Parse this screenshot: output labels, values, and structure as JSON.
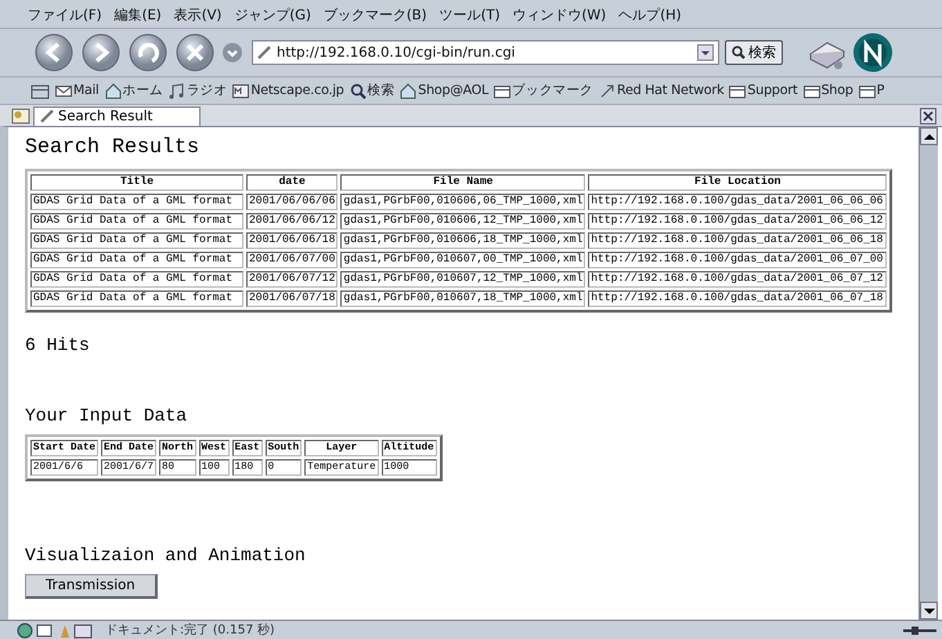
{
  "menu": [
    "ファイル(F)",
    "編集(E)",
    "表示(V)",
    "ジャンプ(G)",
    "ブックマーク(B)",
    "ツール(T)",
    "ウィンドウ(W)",
    "ヘルプ(H)"
  ],
  "address": {
    "value": "http://192.168.0.10/cgi-bin/run.cgi"
  },
  "search_button": "検索",
  "personal_bar": [
    {
      "label": "Mail",
      "kind": "mail"
    },
    {
      "label": "ホーム",
      "kind": "home"
    },
    {
      "label": "ラジオ",
      "kind": "music"
    },
    {
      "label": "Netscape.co.jp",
      "kind": "badge"
    },
    {
      "label": "検索",
      "kind": "search"
    },
    {
      "label": "Shop@AOL",
      "kind": "home"
    },
    {
      "label": "ブックマーク",
      "kind": "folder"
    },
    {
      "label": "Red Hat Network",
      "kind": "link"
    },
    {
      "label": "Support",
      "kind": "folder"
    },
    {
      "label": "Shop",
      "kind": "folder"
    },
    {
      "label": "P",
      "kind": "folder"
    }
  ],
  "tabs": [
    {
      "label": "Search Result",
      "selected": true
    }
  ],
  "page": {
    "heading": "Search Results",
    "results": {
      "columns": [
        "Title",
        "date",
        "File Name",
        "File Location"
      ],
      "rows": [
        [
          "GDAS Grid Data of a GML format",
          "2001/06/06/06",
          "gdas1,PGrbF00,010606,06_TMP_1000,xml",
          "http://192.168.0.100/gdas_data/2001_06_06_06"
        ],
        [
          "GDAS Grid Data of a GML format",
          "2001/06/06/12",
          "gdas1,PGrbF00,010606,12_TMP_1000,xml",
          "http://192.168.0.100/gdas_data/2001_06_06_12"
        ],
        [
          "GDAS Grid Data of a GML format",
          "2001/06/06/18",
          "gdas1,PGrbF00,010606,18_TMP_1000,xml",
          "http://192.168.0.100/gdas_data/2001_06_06_18"
        ],
        [
          "GDAS Grid Data of a GML format",
          "2001/06/07/00",
          "gdas1,PGrbF00,010607,00_TMP_1000,xml",
          "http://192.168.0.100/gdas_data/2001_06_07_00"
        ],
        [
          "GDAS Grid Data of a GML format",
          "2001/06/07/12",
          "gdas1,PGrbF00,010607,12_TMP_1000,xml",
          "http://192.168.0.100/gdas_data/2001_06_07_12"
        ],
        [
          "GDAS Grid Data of a GML format",
          "2001/06/07/18",
          "gdas1,PGrbF00,010607,18_TMP_1000,xml",
          "http://192.168.0.100/gdas_data/2001_06_07_18"
        ]
      ]
    },
    "hits": "6 Hits",
    "input_heading": "Your Input Data",
    "input": {
      "columns": [
        "Start Date",
        "End Date",
        "North",
        "West",
        "East",
        "South",
        "Layer",
        "Altitude"
      ],
      "rows": [
        [
          "2001/6/6",
          "2001/6/7",
          "80",
          "100",
          "180",
          "0",
          "Temperature",
          "1000"
        ]
      ]
    },
    "vis_heading": "Visualizaion and Animation",
    "button": "Transmission"
  },
  "status_bar": {
    "text": "ドキュメント:完了 (0.157 秒)"
  }
}
